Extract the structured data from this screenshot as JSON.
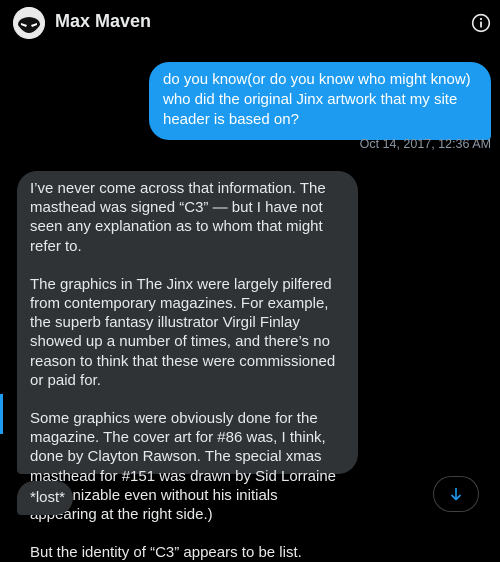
{
  "header": {
    "title": "Max Maven",
    "avatar_icon": "masked-face-avatar",
    "info_icon": "info-icon"
  },
  "messages": {
    "outgoing": {
      "text": "do you know(or do you know who might know) who did the original Jinx artwork that my site header is based on?",
      "timestamp": "Oct 14, 2017, 12:36 AM"
    },
    "incoming": {
      "paragraphs": [
        "I’ve never come across that information. The masthead was signed “C3” — but I have not seen any explanation as to whom that might refer to.",
        "The graphics in The Jinx were largely pilfered from contemporary magazines. For example, the superb fantasy illustrator Virgil Finlay showed up a number of times, and there’s no reason to think that these were commissioned or paid for.",
        "Some graphics were obviously done for the magazine. The cover art for #86 was, I think, done by Clayton Rawson. The special xmas masthead for #151 was drawn by Sid Lorraine (recognizable even without his initials appearing at the right side.)",
        "But the identity of “C3” appears to be list."
      ]
    },
    "incoming_small": {
      "text": "*lost*"
    }
  },
  "controls": {
    "scroll_down_icon": "arrow-down-icon"
  },
  "colors": {
    "background": "#000000",
    "outgoing_bubble": "#1d9bf0",
    "incoming_bubble": "#2f3336",
    "timestamp": "#8b98a5"
  }
}
